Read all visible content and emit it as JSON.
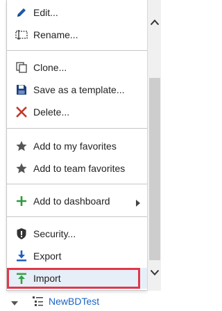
{
  "menu": {
    "items": [
      {
        "label": "Edit...",
        "icon": "pencil-icon"
      },
      {
        "label": "Rename...",
        "icon": "rename-icon"
      },
      {
        "label": "Clone...",
        "icon": "clone-icon"
      },
      {
        "label": "Save as a template...",
        "icon": "save-icon"
      },
      {
        "label": "Delete...",
        "icon": "delete-x-icon"
      },
      {
        "label": "Add to my favorites",
        "icon": "star-icon"
      },
      {
        "label": "Add to team favorites",
        "icon": "star-icon"
      },
      {
        "label": "Add to dashboard",
        "icon": "plus-icon"
      },
      {
        "label": "Security...",
        "icon": "shield-icon"
      },
      {
        "label": "Export",
        "icon": "export-icon"
      },
      {
        "label": "Import",
        "icon": "import-icon"
      }
    ]
  },
  "tree": {
    "item_label": "NewBDTest"
  },
  "colors": {
    "pencil": "#1e5aa8",
    "delete": "#c0392b",
    "plus": "#2e9a3a",
    "export": "#1f5fbf",
    "import": "#3aa04a",
    "highlight_border": "#e0384a",
    "link": "#1a63c6"
  }
}
